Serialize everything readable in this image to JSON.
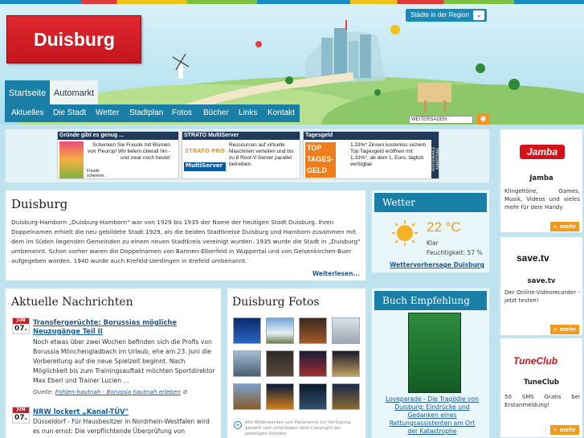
{
  "header": {
    "logo_text": "Duisburg",
    "region_button": "Städte in der Region",
    "share_label": "WEITERSAGEN"
  },
  "nav": {
    "tabs": [
      {
        "label": "Startseite"
      },
      {
        "label": "Automarkt"
      }
    ],
    "items": [
      {
        "label": "Aktuelles"
      },
      {
        "label": "Die Stadt"
      },
      {
        "label": "Wetter"
      },
      {
        "label": "Stadtplan"
      },
      {
        "label": "Fotos"
      },
      {
        "label": "Bücher"
      },
      {
        "label": "Links"
      },
      {
        "label": "Kontakt"
      }
    ]
  },
  "ads": [
    {
      "title": "Gründe gibt es genug ...",
      "text": "Schenken Sie Freude mit Blumen von Fleurop! Wir liefern überall hin - und zwar noch heute!",
      "badge": "Freude schenken."
    },
    {
      "title": "STRATO MultiServer",
      "logo1": "STRATO PRO",
      "logo2": "MultiServer",
      "text": "Ressourcen auf virtuelle Maschinen verteilen und bis zu 8 Root-V-Server parallel betreiben."
    },
    {
      "title": "Tagesgeld",
      "logo": "TOP TAGES-GELD",
      "text": "1,33%* Zinsen kostenlos sichern Top Tagesgeld eröffnen mit 1,33%*, ab dem 1. Euro, täglich verfügbar",
      "sidebar": "PERFORMANCE ADVERTISING"
    }
  ],
  "intro": {
    "title": "Duisburg",
    "text": "Duisburg-Hamborn „Duisburg-Hamborn\" war von 1929 bis 1935 der Name der heutigen Stadt Duisburg. Ihren Doppelnamen erhielt die neu gebildete Stadt 1929, als die beiden Stadtkreise Duisburg und Hamborn zusammen mit dem im Süden liegenden Gemeinden zu einem neuen Stadtkreis vereinigt wurden. 1935 wurde die Stadt in „Duisburg\" umbenannt. Schon vorher waren die Doppelnamen von Barmen-Elberfeld in Wuppertal und von Gelsenkirchen-Buer aufgegeben worden. 1940 wurde auch Krefeld-Uerdingen in Krefeld umbenannt.",
    "more": "Weiterlesen..."
  },
  "news": {
    "title": "Aktuelle Nachrichten",
    "items": [
      {
        "month": "JUN",
        "day": "07.",
        "headline": "Transfergerüchte: Borussias mögliche Neuzugänge Teil II",
        "body": "Noch etwas über zwei Wochen befinden sich die Profis von Borussia Mönchengladbach im Urlaub, ehe am 23. Juni die Vorbereitung auf die neue Spielzeit beginnt. Nach Möglichkeit bis zum Trainingsauftakt möchten Sportdirektor Max Eberl und Trainer Lucien ...",
        "source_label": "Quelle:",
        "source": "Fohlen-hautnah - Borussia hautnah erleben"
      },
      {
        "month": "JUN",
        "day": "07.",
        "headline": "NRW lockert „Kanal-TÜV\"",
        "body": "Düsseldorf - Für Hausbesitzer in Nordrhein-Westfalen wird es nun ernst: Die verpflichtende Überprüfung von Abwasserrohren"
      }
    ]
  },
  "photos": {
    "title": "Duisburg Fotos",
    "note": "Alle Bilderwerden von Panoramio zur Verfügung gestellt und unterliegen dem Copyright der jeweiligen Urheber."
  },
  "weather": {
    "title": "Wetter",
    "temp": "22 °C",
    "condition": "Klar",
    "humidity": "Feuchtigkeit: 57 %",
    "link": "Wettervorhersage Duisburg"
  },
  "recommend": {
    "title": "Buch Empfehlung",
    "book_caption": "Loveparade - Die Tragödie von Duisburg: Eindrücke und Gedanken eines Rettungsassistenten am Ort der Katastrophe"
  },
  "promos": [
    {
      "logo": "Jamba",
      "name": "Jamba",
      "text": "Klingeltöne, Games, Musik, Videos und vieles mehr für dein Handy",
      "more": "mehr"
    },
    {
      "logo": "save.tv",
      "name": "save.tv",
      "text": "Der Online-Videorecorder - jetzt testen!",
      "more": "mehr"
    },
    {
      "logo": "TuneClub",
      "name": "TuneClub",
      "text": "50 SMS Gratis bei Erstanmeldung!",
      "more": "mehr"
    }
  ]
}
